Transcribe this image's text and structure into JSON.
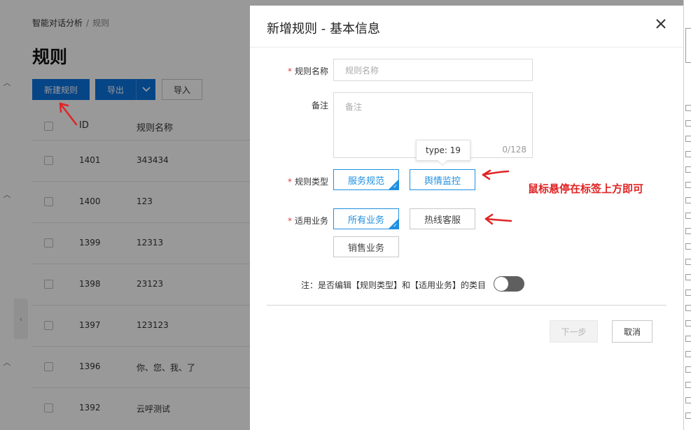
{
  "background": {
    "breadcrumb": {
      "parent": "智能对话分析",
      "separator": "/",
      "current": "规则"
    },
    "title": "规则",
    "toolbar": {
      "new_rule": "新建规则",
      "export": "导出",
      "import": "导入"
    },
    "table": {
      "columns": [
        "ID",
        "规则名称"
      ],
      "rows": [
        {
          "id": "1401",
          "name": "343434"
        },
        {
          "id": "1400",
          "name": "123"
        },
        {
          "id": "1399",
          "name": "12313"
        },
        {
          "id": "1398",
          "name": "23123"
        },
        {
          "id": "1397",
          "name": "123123"
        },
        {
          "id": "1396",
          "name": "你、您、我、了"
        },
        {
          "id": "1392",
          "name": "云呼测试"
        }
      ]
    }
  },
  "dialog": {
    "title": "新增规则 - 基本信息",
    "fields": {
      "rule_name": {
        "label": "规则名称",
        "placeholder": "规则名称"
      },
      "remark": {
        "label": "备注",
        "placeholder": "备注",
        "counter": "0/128"
      },
      "rule_type": {
        "label": "规则类型",
        "tags": [
          "服务规范",
          "舆情监控"
        ]
      },
      "business": {
        "label": "适用业务",
        "tags": [
          "所有业务",
          "热线客服",
          "销售业务"
        ]
      }
    },
    "tooltip": "type: 19",
    "note": "注：是否编辑【规则类型】和【适用业务】的类目",
    "buttons": {
      "next": "下一步",
      "cancel": "取消"
    }
  },
  "annotation": "鼠标悬停在标签上方即可",
  "colors": {
    "accent": "#1e8fe1",
    "primary": "#0a73e0",
    "annotation": "#e02424",
    "mask": "rgba(0,0,0,0.40)"
  },
  "icons": {
    "close": "close-icon",
    "caret": "chevron-down-icon",
    "check": "check-icon"
  }
}
